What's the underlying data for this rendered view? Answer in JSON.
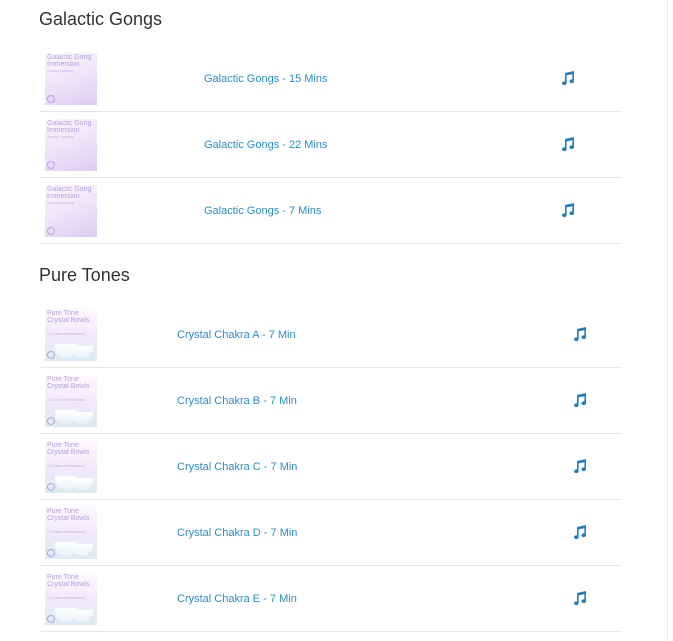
{
  "colors": {
    "link": "#2a8ec8",
    "icon": "#1f7fc0",
    "divider": "#e6e6e6",
    "heading": "#333333"
  },
  "sections": [
    {
      "title": "Galactic Gongs",
      "tracks": [
        {
          "title": "Galactic Gongs - 15 Mins",
          "cover_title": "Galactic Gong\nImmersion",
          "cover_sub": "Sound Journey",
          "icon": "music-note-icon"
        },
        {
          "title": "Galactic Gongs - 22 Mins",
          "cover_title": "Galactic Gong\nImmersion",
          "cover_sub": "Sound Journey",
          "icon": "music-note-icon"
        },
        {
          "title": "Galactic Gongs - 7 Mins",
          "cover_title": "Galactic Gong\nImmersion",
          "cover_sub": "Sound Journey",
          "icon": "music-note-icon"
        }
      ]
    },
    {
      "title": "Pure Tones",
      "tracks": [
        {
          "title": "Crystal Chakra A - 7 Min",
          "cover_title": "Pure Tone\nCrystal Bowls",
          "cover_sub": "7 Chakra Meditations",
          "icon": "music-note-icon"
        },
        {
          "title": "Crystal Chakra B - 7 Min",
          "cover_title": "Pure Tone\nCrystal Bowls",
          "cover_sub": "7 Chakra Meditations",
          "icon": "music-note-icon"
        },
        {
          "title": "Crystal Chakra C - 7 Min",
          "cover_title": "Pure Tone\nCrystal Bowls",
          "cover_sub": "7 Chakra Meditations",
          "icon": "music-note-icon"
        },
        {
          "title": "Crystal Chakra D - 7 Min",
          "cover_title": "Pure Tone\nCrystal Bowls",
          "cover_sub": "7 Chakra Meditations",
          "icon": "music-note-icon"
        },
        {
          "title": "Crystal Chakra E - 7 Min",
          "cover_title": "Pure Tone\nCrystal Bowls",
          "cover_sub": "7 Chakra Meditations",
          "icon": "music-note-icon"
        }
      ]
    }
  ]
}
